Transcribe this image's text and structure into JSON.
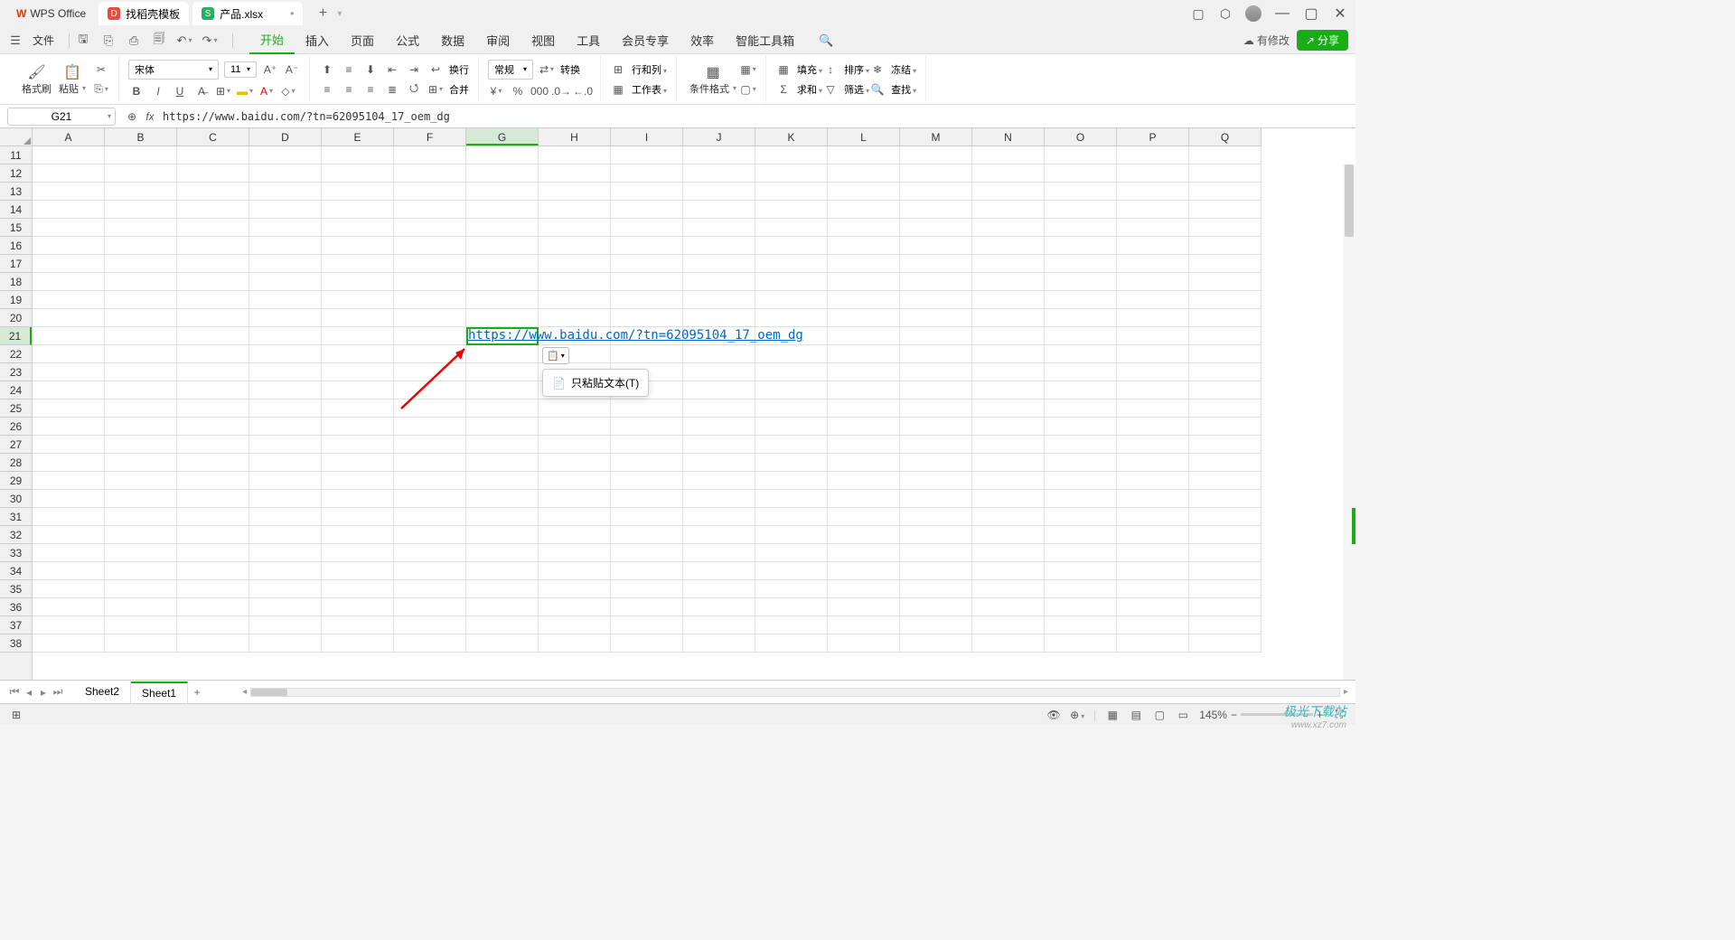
{
  "titlebar": {
    "wps_label": "WPS Office",
    "template_label": "找稻壳模板",
    "file_label": "产品.xlsx"
  },
  "menubar": {
    "file": "文件",
    "tabs": [
      "开始",
      "插入",
      "页面",
      "公式",
      "数据",
      "审阅",
      "视图",
      "工具",
      "会员专享",
      "效率",
      "智能工具箱"
    ],
    "active_index": 0,
    "modify": "有修改",
    "share": "分享"
  },
  "ribbon": {
    "format_brush": "格式刷",
    "paste": "粘贴",
    "font_name": "宋体",
    "font_size": "11",
    "wrap": "换行",
    "merge": "合并",
    "number_format": "常规",
    "transform": "转换",
    "rowcol": "行和列",
    "sheet": "工作表",
    "condfmt": "条件格式",
    "fill": "填充",
    "sort": "排序",
    "freeze": "冻结",
    "sum": "求和",
    "filter": "筛选",
    "find": "查找"
  },
  "formula": {
    "cell_ref": "G21",
    "fx": "fx",
    "text": "https://www.baidu.com/?tn=62095104_17_oem_dg"
  },
  "grid": {
    "cols": [
      "A",
      "B",
      "C",
      "D",
      "E",
      "F",
      "G",
      "H",
      "I",
      "J",
      "K",
      "L",
      "M",
      "N",
      "O",
      "P",
      "Q"
    ],
    "rows_start": 11,
    "rows_end": 38,
    "sel_col": "G",
    "sel_row": 21,
    "cell_content": "https://www.baidu.com/?tn=62095104_17_oem_dg"
  },
  "paste_popup": {
    "only_text": "只粘贴文本(T)"
  },
  "sheets": {
    "items": [
      "Sheet2",
      "Sheet1"
    ],
    "active_index": 1
  },
  "status": {
    "zoom": "145%"
  },
  "watermark": {
    "line1": "极光下载站",
    "line2": "www.xz7.com"
  }
}
